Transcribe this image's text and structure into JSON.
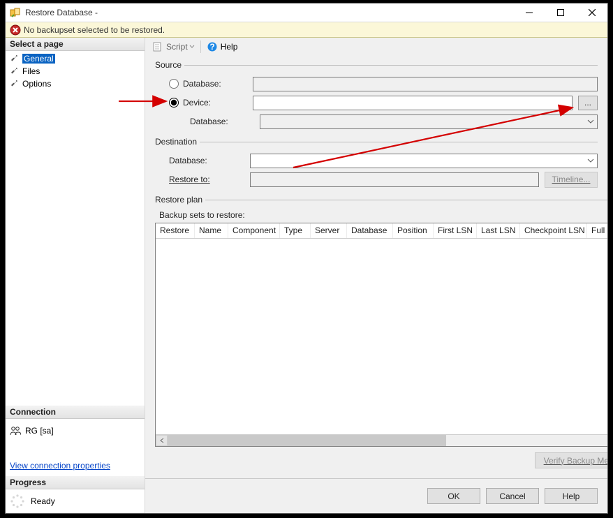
{
  "window": {
    "title": "Restore Database -"
  },
  "warning": {
    "message": "No backupset selected to be restored."
  },
  "sidebar": {
    "header": "Select a page",
    "pages": [
      {
        "label": "General"
      },
      {
        "label": "Files"
      },
      {
        "label": "Options"
      }
    ],
    "connection_header": "Connection",
    "connection_value": "RG [sa]",
    "view_properties": "View connection properties",
    "progress_header": "Progress",
    "progress_text": "Ready"
  },
  "toolbar": {
    "script": "Script",
    "help": "Help"
  },
  "source": {
    "legend": "Source",
    "database_label": "Database:",
    "device_label": "Device:",
    "device_value": "",
    "browse": "...",
    "inner_database_label": "Database:"
  },
  "destination": {
    "legend": "Destination",
    "database_label": "Database:",
    "database_value": "",
    "restore_to_label": "Restore to:",
    "restore_to_value": "",
    "timeline_label": "Timeline..."
  },
  "restore_plan": {
    "legend": "Restore plan",
    "sub_label": "Backup sets to restore:",
    "columns": [
      "Restore",
      "Name",
      "Component",
      "Type",
      "Server",
      "Database",
      "Position",
      "First LSN",
      "Last LSN",
      "Checkpoint LSN",
      "Full LSN"
    ],
    "verify_label": "Verify Backup Media"
  },
  "footer": {
    "ok": "OK",
    "cancel": "Cancel",
    "help": "Help"
  }
}
